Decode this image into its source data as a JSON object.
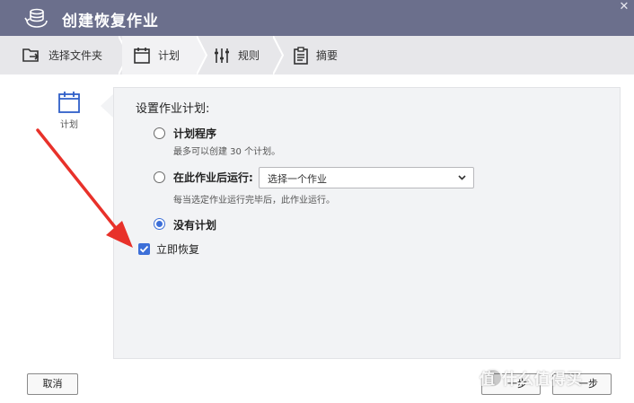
{
  "window": {
    "title": "创建恢复作业",
    "close_glyph": "✕"
  },
  "steps": [
    {
      "label": "选择文件夹",
      "icon": "folder-icon"
    },
    {
      "label": "计划",
      "icon": "calendar-icon"
    },
    {
      "label": "规则",
      "icon": "sliders-icon"
    },
    {
      "label": "摘要",
      "icon": "clipboard-icon"
    }
  ],
  "sidebar": {
    "item_label": "计划",
    "icon": "calendar-icon"
  },
  "panel": {
    "section_title": "设置作业计划:",
    "options": [
      {
        "label": "计划程序",
        "desc": "最多可以创建 30 个计划。",
        "checked": false
      },
      {
        "label": "在此作业后运行:",
        "desc": "每当选定作业运行完毕后，此作业运行。",
        "checked": false
      },
      {
        "label": "没有计划",
        "desc": "",
        "checked": true
      }
    ],
    "select_value": "选择一个作业",
    "checkbox_label": "立即恢复",
    "checkbox_checked": true
  },
  "footer": {
    "cancel": "取消",
    "prev": "一步",
    "next": "一步"
  },
  "watermark": "值 什么值得买",
  "colors": {
    "titlebar": "#6b6f8c",
    "accent": "#3d6fd8",
    "arrow": "#e8312a"
  }
}
